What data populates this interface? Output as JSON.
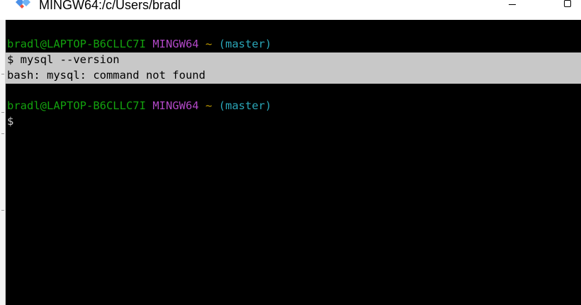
{
  "window": {
    "title": "MINGW64:/c/Users/bradl"
  },
  "icons": {
    "app": "git-diamond-icon",
    "minimize": "minimize-icon",
    "maximize": "maximize-icon"
  },
  "colors": {
    "terminal_bg": "#000000",
    "user_host": "#13a10e",
    "mingw": "#b148c6",
    "tilde": "#c19c00",
    "branch": "#2aa6b8",
    "selection": "#c8c8c8"
  },
  "terminal": {
    "prompt1": {
      "user_host": "bradl@LAPTOP-B6CLLC7I",
      "system": "MINGW64",
      "path": "~",
      "branch": "(master)"
    },
    "command_line": "$ mysql --version",
    "error_line": "bash: mysql: command not found",
    "prompt2": {
      "user_host": "bradl@LAPTOP-B6CLLC7I",
      "system": "MINGW64",
      "path": "~",
      "branch": "(master)"
    },
    "input_line": "$"
  }
}
